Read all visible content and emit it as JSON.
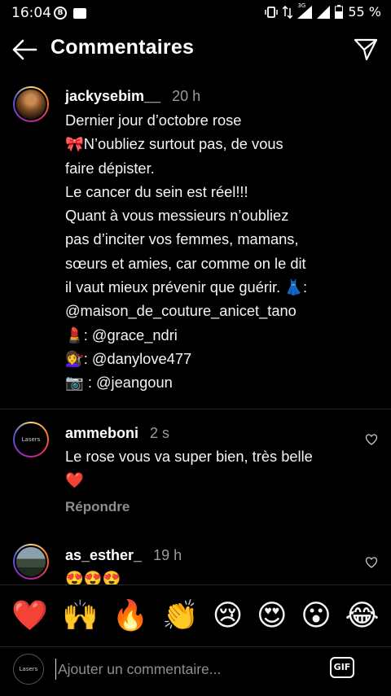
{
  "status_bar": {
    "time": "16:04",
    "b_badge": "B",
    "network": "3G",
    "battery": "55 %"
  },
  "header": {
    "title": "Commentaires"
  },
  "comments": [
    {
      "username": "jackysebim__",
      "time": "20 h",
      "lines": [
        "Dernier jour d’octobre rose",
        "🎀N’oubliez surtout pas, de vous",
        "faire dépister.",
        "Le cancer du sein est réel!!!",
        "Quant à vous messieurs n’oubliez",
        "pas d’inciter vos femmes, mamans,",
        "sœurs et amies, car comme on le dit",
        "il vaut mieux prévenir que guérir. 👗:",
        "@maison_de_couture_anicet_tano",
        "💄: @grace_ndri",
        "💇‍♀️: @danylove477",
        "📷 : @jeangoun"
      ]
    },
    {
      "username": "ammeboni",
      "time": "2 s",
      "avatar_text": "Lasers",
      "lines": [
        "Le rose vous va super bien, très belle",
        "❤️"
      ],
      "reply_label": "Répondre"
    },
    {
      "username": "as_esther_",
      "time": "19 h",
      "lines": [
        "😍😍😍"
      ]
    }
  ],
  "emoji_bar": [
    "❤️",
    "🙌",
    "🔥",
    "👏",
    "😢",
    "😍",
    "😮",
    "😂"
  ],
  "input": {
    "placeholder": "Ajouter un commentaire...",
    "gif_label": "GIF",
    "avatar_text": "Lasers"
  },
  "colors": {
    "background": "#000000",
    "text": "#f5f5f5",
    "muted": "#8e8e8e",
    "divider": "#262626"
  }
}
